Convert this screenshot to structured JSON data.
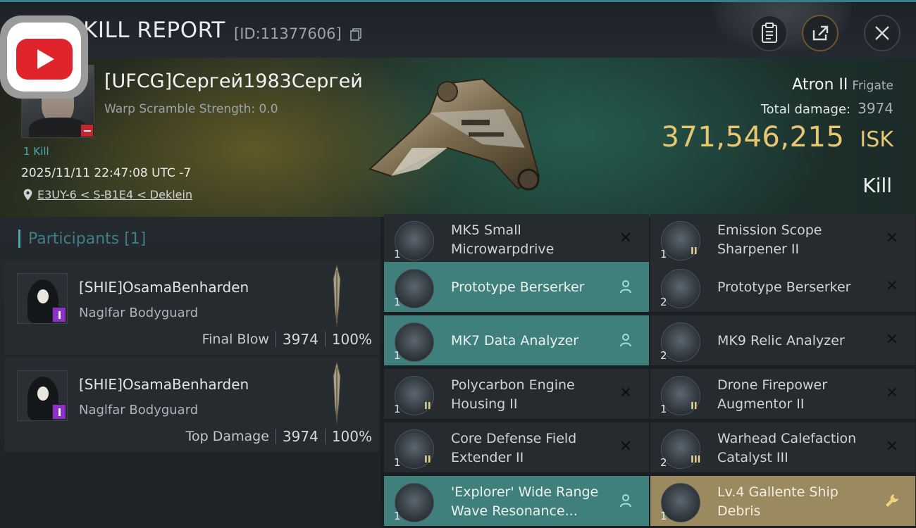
{
  "header": {
    "title": "KILL REPORT",
    "report_id": "[ID:11377606]"
  },
  "victim": {
    "name": "[UFCG]Сергей1983Сергей",
    "warp_scramble": "Warp Scramble Strength: 0.0",
    "kill_count": "1 Kill",
    "timestamp": "2025/11/11 22:47:08 UTC -7",
    "location": "E3UY-6 < S-B1E4 < Deklein"
  },
  "ship": {
    "name": "Atron II",
    "class": "Frigate",
    "total_damage_label": "Total damage:",
    "total_damage": "3974",
    "isk_value": "371,546,215",
    "isk_unit": "ISK",
    "result": "Kill"
  },
  "participants": {
    "title": "Participants [1]",
    "cards": [
      {
        "name": "[SHIE]OsamaBenharden",
        "ship": "Naglfar Bodyguard",
        "role": "Final Blow",
        "damage": "3974",
        "percent": "100%"
      },
      {
        "name": "[SHIE]OsamaBenharden",
        "ship": "Naglfar Bodyguard",
        "role": "Top Damage",
        "damage": "3974",
        "percent": "100%"
      }
    ]
  },
  "modules": [
    {
      "name": "MK5 Small Microwarpdrive",
      "qty": "1",
      "tier": "",
      "state": "destroyed",
      "icon": "microwarpdrive-icon"
    },
    {
      "name": "Emission Scope Sharpener II",
      "qty": "1",
      "tier": "II",
      "state": "destroyed",
      "icon": "scope-icon"
    },
    {
      "name": "Prototype  Berserker",
      "qty": "1",
      "tier": "",
      "state": "dropped",
      "icon": "drone-icon"
    },
    {
      "name": "Prototype  Berserker",
      "qty": "2",
      "tier": "",
      "state": "destroyed",
      "icon": "drone-icon"
    },
    {
      "name": "MK7 Data Analyzer",
      "qty": "1",
      "tier": "",
      "state": "dropped",
      "icon": "data-analyzer-icon"
    },
    {
      "name": "MK9 Relic Analyzer",
      "qty": "2",
      "tier": "",
      "state": "destroyed",
      "icon": "relic-analyzer-icon"
    },
    {
      "name": "Polycarbon Engine Housing II",
      "qty": "1",
      "tier": "II",
      "state": "destroyed",
      "icon": "engine-icon"
    },
    {
      "name": "Drone Firepower Augmentor II",
      "qty": "1",
      "tier": "II",
      "state": "destroyed",
      "icon": "drone-augmentor-icon"
    },
    {
      "name": "Core Defense Field Extender II",
      "qty": "1",
      "tier": "II",
      "state": "destroyed",
      "icon": "shield-extender-icon"
    },
    {
      "name": "Warhead Calefaction Catalyst III",
      "qty": "2",
      "tier": "III",
      "state": "destroyed",
      "icon": "warhead-icon"
    },
    {
      "name": "'Explorer' Wide Range Wave Resonance...",
      "qty": "1",
      "tier": "",
      "state": "dropped",
      "icon": "scanner-icon"
    },
    {
      "name": "Lv.4 Gallente Ship Debris",
      "qty": "1",
      "tier": "",
      "state": "salvage",
      "icon": "debris-icon"
    }
  ],
  "colors": {
    "accent_teal": "#3f7f7c",
    "salvage_gold": "#9b8a5f",
    "isk_gold": "#e8c773",
    "participants_title": "#3f7f86"
  }
}
